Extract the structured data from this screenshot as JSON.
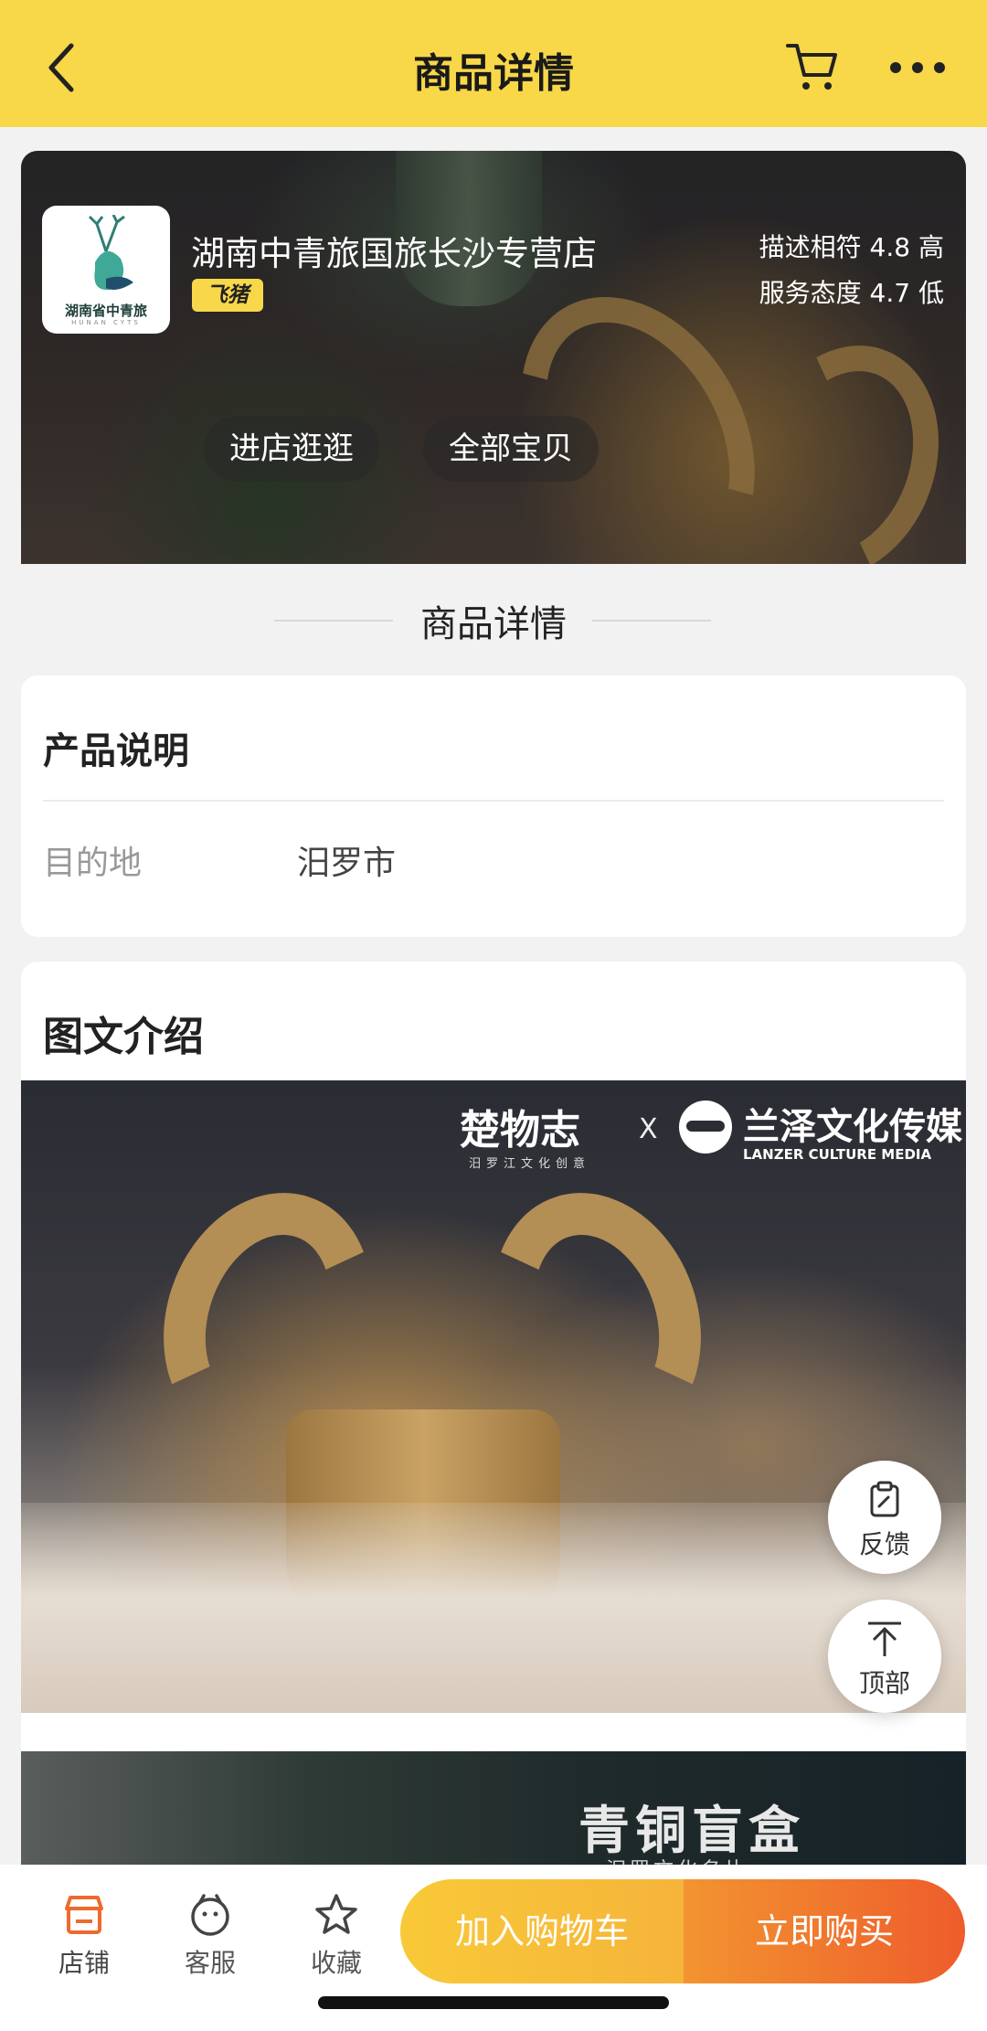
{
  "header": {
    "title": "商品详情"
  },
  "store": {
    "name": "湖南中青旅国旅长沙专营店",
    "badge": "飞猪",
    "logo_text": "湖南省中青旅",
    "logo_sub": "HUNAN CYTS",
    "rating_desc": "描述相符 4.8 高",
    "rating_service": "服务态度 4.7 低",
    "visit_button": "进店逛逛",
    "all_items_button": "全部宝贝"
  },
  "section_title": "商品详情",
  "product_info": {
    "title": "产品说明",
    "destination_label": "目的地",
    "destination_value": "汨罗市"
  },
  "intro": {
    "title": "图文介绍",
    "hero": {
      "brand1": "楚物志",
      "brand1_sub": "汨罗江文化创意",
      "x": "X",
      "brand2": "兰泽文化传媒",
      "brand2_sub": "LANZER CULTURE MEDIA"
    },
    "second": {
      "title": "青铜盲盒",
      "sub": "汨罗文化名片"
    }
  },
  "floating": {
    "feedback": "反馈",
    "top": "顶部"
  },
  "bottom_bar": {
    "store": "店铺",
    "service": "客服",
    "favorite": "收藏",
    "add_to_cart": "加入购物车",
    "buy_now": "立即购买"
  },
  "colors": {
    "header_bg": "#f8d749",
    "cart_btn": "#f7be39",
    "buy_btn": "#ee6a2d",
    "store_tab": "#ee6a2d"
  }
}
